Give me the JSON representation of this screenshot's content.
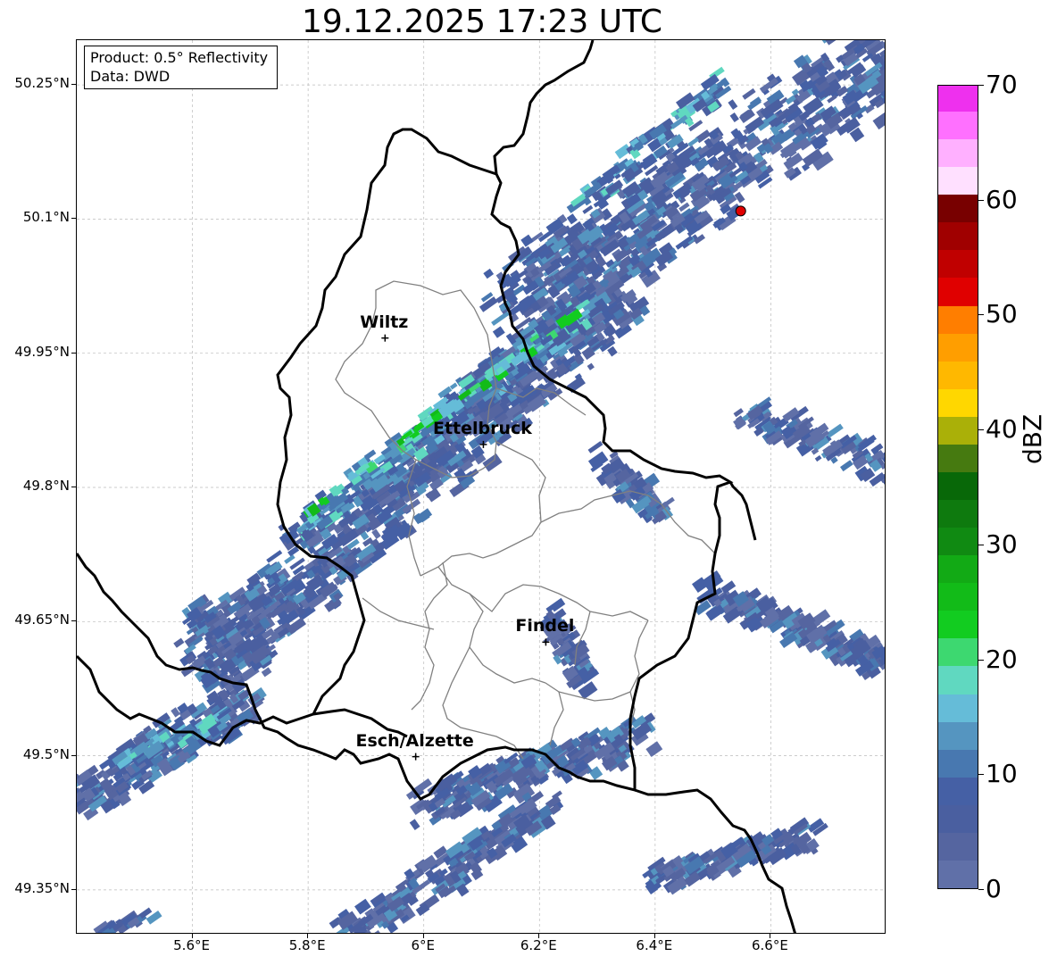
{
  "title": "19.12.2025 17:23 UTC",
  "info_box": {
    "product": "Product: 0.5° Reflectivity",
    "data": "Data: DWD"
  },
  "axes": {
    "lat_ticks": [
      "50.25°N",
      "50.1°N",
      "49.95°N",
      "49.8°N",
      "49.65°N",
      "49.5°N",
      "49.35°N"
    ],
    "lon_ticks": [
      "5.6°E",
      "5.8°E",
      "6°E",
      "6.2°E",
      "6.4°E",
      "6.6°E"
    ],
    "lat_range": [
      49.3,
      50.3
    ],
    "lon_range": [
      5.4,
      6.8
    ],
    "grid": true
  },
  "cities": [
    {
      "name": "Wiltz",
      "lat": 49.967,
      "lon": 5.933
    },
    {
      "name": "Ettelbruck",
      "lat": 49.848,
      "lon": 6.103
    },
    {
      "name": "Findel",
      "lat": 49.627,
      "lon": 6.211
    },
    {
      "name": "Esch/Alzette",
      "lat": 49.499,
      "lon": 5.986
    }
  ],
  "radar_marker": {
    "lat": 50.109,
    "lon": 6.548,
    "color": "#e00000"
  },
  "colorbar": {
    "label": "dBZ",
    "ticks": [
      "0",
      "10",
      "20",
      "30",
      "40",
      "50",
      "60",
      "70"
    ],
    "min": 0,
    "max": 70,
    "colors": [
      "#6070a8",
      "#5565a0",
      "#4a5fa0",
      "#4560a5",
      "#4878b0",
      "#5595c0",
      "#65bcd8",
      "#60d8c0",
      "#3dd870",
      "#12cc20",
      "#12bb18",
      "#12aa15",
      "#108a12",
      "#0e7a0e",
      "#086808",
      "#467a10",
      "#aab008",
      "#ffd700",
      "#ffb800",
      "#ff9e00",
      "#ff7e00",
      "#e00000",
      "#c00000",
      "#a00000",
      "#780000",
      "#ffe0ff",
      "#ffb0ff",
      "#ff70ff",
      "#ee30ee"
    ]
  }
}
